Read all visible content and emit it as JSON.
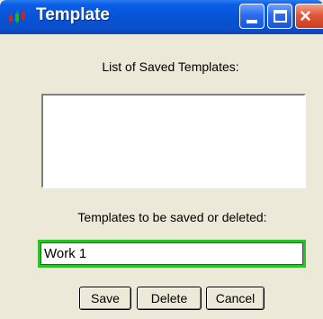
{
  "window": {
    "title": "Template",
    "minimize_icon": "minimize-icon",
    "maximize_icon": "maximize-icon",
    "close_glyph": "×"
  },
  "dialog": {
    "list_label": "List of Saved Templates:",
    "saved_templates": [],
    "save_label": "Templates to be saved or deleted:",
    "name_value": "Work 1",
    "focus_color": "#28c428"
  },
  "buttons": {
    "save": "Save",
    "delete": "Delete",
    "cancel": "Cancel"
  }
}
